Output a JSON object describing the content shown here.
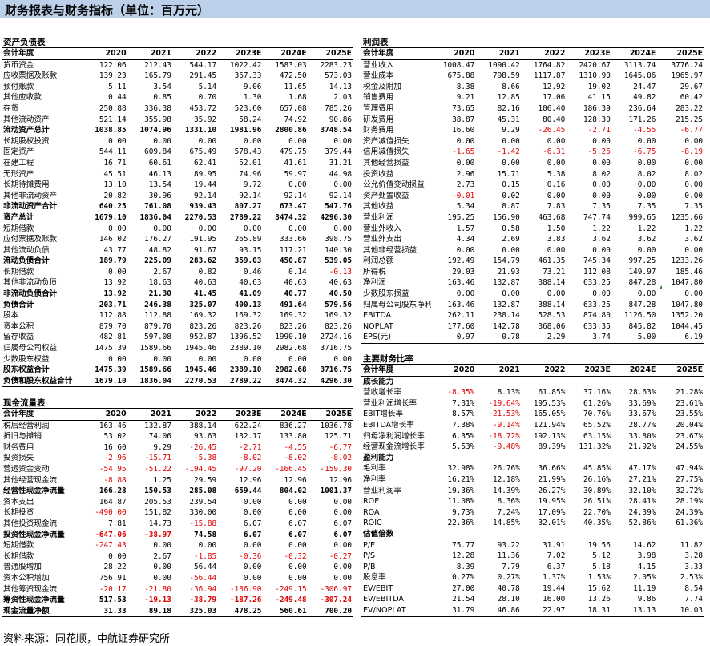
{
  "page_title": "财务报表与财务指标（单位：百万元）",
  "source_note": "资料来源：同花顺，中航证券研究所",
  "years": [
    "2020",
    "2021",
    "2022",
    "2023E",
    "2024E",
    "2025E"
  ],
  "balance_sheet": {
    "title": "资产负债表",
    "header": "会计年度",
    "rows": [
      {
        "label": "货币资金",
        "values": [
          "122.06",
          "212.43",
          "544.17",
          "1022.42",
          "1583.03",
          "2283.23"
        ]
      },
      {
        "label": "应收票据及账款",
        "values": [
          "139.23",
          "165.79",
          "291.45",
          "367.33",
          "472.50",
          "573.03"
        ]
      },
      {
        "label": "预付账款",
        "values": [
          "5.11",
          "3.54",
          "5.14",
          "9.06",
          "11.65",
          "14.13"
        ]
      },
      {
        "label": "其他应收款",
        "values": [
          "0.44",
          "0.85",
          "0.70",
          "1.30",
          "1.68",
          "2.03"
        ]
      },
      {
        "label": "存货",
        "values": [
          "250.88",
          "336.38",
          "453.72",
          "523.60",
          "657.08",
          "785.26"
        ]
      },
      {
        "label": "其他流动资产",
        "values": [
          "521.14",
          "355.98",
          "35.92",
          "58.24",
          "74.92",
          "90.86"
        ]
      },
      {
        "label": "流动资产总计",
        "bold": true,
        "values": [
          "1038.85",
          "1074.96",
          "1331.10",
          "1981.96",
          "2800.86",
          "3748.54"
        ]
      },
      {
        "label": "长期股权投资",
        "values": [
          "0.00",
          "0.00",
          "0.00",
          "0.00",
          "0.00",
          "0.00"
        ]
      },
      {
        "label": "固定资产",
        "values": [
          "544.11",
          "609.84",
          "675.49",
          "578.43",
          "479.75",
          "379.44"
        ]
      },
      {
        "label": "在建工程",
        "values": [
          "16.71",
          "60.61",
          "62.41",
          "52.01",
          "41.61",
          "31.21"
        ]
      },
      {
        "label": "无形资产",
        "values": [
          "45.51",
          "46.13",
          "89.95",
          "74.96",
          "59.97",
          "44.98"
        ]
      },
      {
        "label": "长期待摊费用",
        "values": [
          "13.10",
          "13.54",
          "19.44",
          "9.72",
          "0.00",
          "0.00"
        ]
      },
      {
        "label": "其他非流动资产",
        "values": [
          "20.82",
          "30.96",
          "92.14",
          "92.14",
          "92.14",
          "92.14"
        ]
      },
      {
        "label": "非流动资产合计",
        "bold": true,
        "values": [
          "640.25",
          "761.08",
          "939.43",
          "807.27",
          "673.47",
          "547.76"
        ]
      },
      {
        "label": "资产总计",
        "bold": true,
        "values": [
          "1679.10",
          "1836.04",
          "2270.53",
          "2789.22",
          "3474.32",
          "4296.30"
        ]
      },
      {
        "label": "短期借款",
        "values": [
          "0.00",
          "0.00",
          "0.00",
          "0.00",
          "0.00",
          "0.00"
        ]
      },
      {
        "label": "应付票据及账款",
        "values": [
          "146.02",
          "176.27",
          "191.95",
          "265.89",
          "333.66",
          "398.75"
        ]
      },
      {
        "label": "其他流动负债",
        "values": [
          "43.77",
          "48.82",
          "91.67",
          "93.15",
          "117.21",
          "140.30"
        ]
      },
      {
        "label": "流动负债合计",
        "bold": true,
        "values": [
          "189.79",
          "225.09",
          "283.62",
          "359.03",
          "450.87",
          "539.05"
        ]
      },
      {
        "label": "长期借款",
        "values": [
          "0.00",
          "2.67",
          "0.82",
          "0.46",
          "0.14",
          "-0.13"
        ]
      },
      {
        "label": "其他非流动负债",
        "values": [
          "13.92",
          "18.63",
          "40.63",
          "40.63",
          "40.63",
          "40.63"
        ]
      },
      {
        "label": "非流动负债合计",
        "bold": true,
        "values": [
          "13.92",
          "21.30",
          "41.45",
          "41.09",
          "40.77",
          "40.50"
        ]
      },
      {
        "label": "负债合计",
        "bold": true,
        "values": [
          "203.71",
          "246.38",
          "325.07",
          "400.13",
          "491.64",
          "579.56"
        ]
      },
      {
        "label": "股本",
        "values": [
          "112.88",
          "112.88",
          "169.32",
          "169.32",
          "169.32",
          "169.32"
        ]
      },
      {
        "label": "资本公积",
        "values": [
          "879.70",
          "879.70",
          "823.26",
          "823.26",
          "823.26",
          "823.26"
        ]
      },
      {
        "label": "留存收益",
        "values": [
          "482.81",
          "597.08",
          "952.87",
          "1396.52",
          "1990.10",
          "2724.16"
        ]
      },
      {
        "label": "归属母公司权益",
        "values": [
          "1475.39",
          "1589.66",
          "1945.46",
          "2389.10",
          "2982.68",
          "3716.75"
        ]
      },
      {
        "label": "少数股东权益",
        "values": [
          "0.00",
          "0.00",
          "0.00",
          "0.00",
          "0.00",
          "0.00"
        ]
      },
      {
        "label": "股东权益合计",
        "bold": true,
        "values": [
          "1475.39",
          "1589.66",
          "1945.46",
          "2389.10",
          "2982.68",
          "3716.75"
        ]
      },
      {
        "label": "负债和股东权益合计",
        "bold": true,
        "values": [
          "1679.10",
          "1836.04",
          "2270.53",
          "2789.22",
          "3474.32",
          "4296.30"
        ]
      }
    ]
  },
  "cash_flow": {
    "title": "现金流量表",
    "header": "会计年度",
    "rows": [
      {
        "label": "税后经营利润",
        "values": [
          "163.46",
          "132.87",
          "388.14",
          "622.24",
          "836.27",
          "1036.78"
        ]
      },
      {
        "label": "折旧与摊销",
        "values": [
          "53.02",
          "74.06",
          "93.63",
          "132.17",
          "133.80",
          "125.71"
        ]
      },
      {
        "label": "财务费用",
        "values": [
          "16.60",
          "9.29",
          "-26.45",
          "-2.71",
          "-4.55",
          "-6.77"
        ]
      },
      {
        "label": "投资损失",
        "values": [
          "-2.96",
          "-15.71",
          "-5.38",
          "-8.02",
          "-8.02",
          "-8.02"
        ]
      },
      {
        "label": "营运资金变动",
        "values": [
          "-54.95",
          "-51.22",
          "-194.45",
          "-97.20",
          "-166.45",
          "-159.30"
        ]
      },
      {
        "label": "其他经营现金流",
        "values": [
          "-8.88",
          "1.25",
          "29.59",
          "12.96",
          "12.96",
          "12.96"
        ]
      },
      {
        "label": "经营性现金净流量",
        "bold": true,
        "values": [
          "166.28",
          "150.53",
          "285.08",
          "659.44",
          "804.02",
          "1001.37"
        ]
      },
      {
        "label": "资本支出",
        "values": [
          "164.87",
          "205.53",
          "239.54",
          "0.00",
          "0.00",
          "0.00"
        ]
      },
      {
        "label": "长期投资",
        "values": [
          "-490.00",
          "151.82",
          "330.00",
          "0.00",
          "0.00",
          "0.00"
        ]
      },
      {
        "label": "其他投资现金流",
        "values": [
          "7.81",
          "14.73",
          "-15.88",
          "6.07",
          "6.07",
          "6.07"
        ]
      },
      {
        "label": "投资性现金净流量",
        "bold": true,
        "values": [
          "-647.06",
          "-38.97",
          "74.58",
          "6.07",
          "6.07",
          "6.07"
        ]
      },
      {
        "label": "短期借款",
        "values": [
          "-247.43",
          "0.00",
          "0.00",
          "0.00",
          "0.00",
          "0.00"
        ]
      },
      {
        "label": "长期借款",
        "values": [
          "0.00",
          "2.67",
          "-1.85",
          "-0.36",
          "-0.32",
          "-0.27"
        ]
      },
      {
        "label": "普通股增加",
        "values": [
          "28.22",
          "0.00",
          "56.44",
          "0.00",
          "0.00",
          "0.00"
        ]
      },
      {
        "label": "资本公积增加",
        "values": [
          "756.91",
          "0.00",
          "-56.44",
          "0.00",
          "0.00",
          "0.00"
        ]
      },
      {
        "label": "其他筹资现金流",
        "values": [
          "-20.17",
          "-21.80",
          "-36.94",
          "-186.90",
          "-249.15",
          "-306.97"
        ]
      },
      {
        "label": "筹资性现金净流量",
        "bold": true,
        "values": [
          "517.53",
          "-19.13",
          "-38.79",
          "-187.26",
          "-249.48",
          "-307.24"
        ]
      },
      {
        "label": "现金流量净额",
        "bold": true,
        "values": [
          "31.33",
          "89.18",
          "325.03",
          "478.25",
          "560.61",
          "700.20"
        ]
      }
    ]
  },
  "income": {
    "title": "利润表",
    "header": "会计年度",
    "rows": [
      {
        "label": "营业收入",
        "values": [
          "1008.47",
          "1090.42",
          "1764.82",
          "2420.67",
          "3113.74",
          "3776.24"
        ]
      },
      {
        "label": "营业成本",
        "values": [
          "675.88",
          "798.59",
          "1117.87",
          "1310.90",
          "1645.06",
          "1965.97"
        ]
      },
      {
        "label": "税金及附加",
        "values": [
          "8.38",
          "8.66",
          "12.92",
          "19.02",
          "24.47",
          "29.67"
        ]
      },
      {
        "label": "销售费用",
        "values": [
          "9.21",
          "12.85",
          "17.06",
          "41.15",
          "49.82",
          "60.42"
        ]
      },
      {
        "label": "管理费用",
        "values": [
          "73.65",
          "82.16",
          "106.40",
          "186.39",
          "236.64",
          "283.22"
        ]
      },
      {
        "label": "研发费用",
        "values": [
          "38.87",
          "45.31",
          "80.40",
          "128.30",
          "171.26",
          "215.25"
        ]
      },
      {
        "label": "财务费用",
        "values": [
          "16.60",
          "9.29",
          "-26.45",
          "-2.71",
          "-4.55",
          "-6.77"
        ]
      },
      {
        "label": "资产减值损失",
        "values": [
          "0.00",
          "0.00",
          "0.00",
          "0.00",
          "0.00",
          "0.00"
        ]
      },
      {
        "label": "信用减值损失",
        "values": [
          "-1.65",
          "-1.42",
          "-6.31",
          "-5.25",
          "-6.75",
          "-8.19"
        ]
      },
      {
        "label": "其他经营损益",
        "values": [
          "0.00",
          "0.00",
          "0.00",
          "0.00",
          "0.00",
          "0.00"
        ]
      },
      {
        "label": "投资收益",
        "values": [
          "2.96",
          "15.71",
          "5.38",
          "8.02",
          "8.02",
          "8.02"
        ]
      },
      {
        "label": "公允价值变动损益",
        "values": [
          "2.73",
          "0.15",
          "0.16",
          "0.00",
          "0.00",
          "0.00"
        ]
      },
      {
        "label": "资产处置收益",
        "values": [
          "-0.01",
          "0.02",
          "0.00",
          "0.00",
          "0.00",
          "0.00"
        ]
      },
      {
        "label": "其他收益",
        "values": [
          "5.34",
          "8.87",
          "7.83",
          "7.35",
          "7.35",
          "7.35"
        ]
      },
      {
        "label": "营业利润",
        "values": [
          "195.25",
          "156.90",
          "463.68",
          "747.74",
          "999.65",
          "1235.66"
        ]
      },
      {
        "label": "营业外收入",
        "values": [
          "1.57",
          "0.58",
          "1.50",
          "1.22",
          "1.22",
          "1.22"
        ]
      },
      {
        "label": "营业外支出",
        "values": [
          "4.34",
          "2.69",
          "3.83",
          "3.62",
          "3.62",
          "3.62"
        ]
      },
      {
        "label": "其他非经营损益",
        "values": [
          "0.00",
          "0.00",
          "0.00",
          "0.00",
          "0.00",
          "0.00"
        ]
      },
      {
        "label": "利润总额",
        "values": [
          "192.49",
          "154.79",
          "461.35",
          "745.34",
          "997.25",
          "1233.26"
        ]
      },
      {
        "label": "所得税",
        "values": [
          "29.03",
          "21.93",
          "73.21",
          "112.08",
          "149.97",
          "185.46"
        ]
      },
      {
        "label": "净利润",
        "values": [
          "163.46",
          "132.87",
          "388.14",
          "633.25",
          "847.28",
          "1047.80"
        ]
      },
      {
        "label": "少数股东损益",
        "values": [
          "0.00",
          "0.00",
          "0.00",
          "0.00",
          "0.00",
          "0.00"
        ]
      },
      {
        "label": "归属母公司股东净利",
        "values": [
          "163.46",
          "132.87",
          "388.14",
          "633.25",
          "847.28",
          "1047.80"
        ]
      },
      {
        "label": "EBITDA",
        "values": [
          "262.11",
          "238.14",
          "528.53",
          "874.80",
          "1126.50",
          "1352.20"
        ]
      },
      {
        "label": "NOPLAT",
        "values": [
          "177.60",
          "142.78",
          "368.06",
          "633.35",
          "845.82",
          "1044.45"
        ]
      },
      {
        "label": "EPS(元)",
        "values": [
          "0.97",
          "0.78",
          "2.29",
          "3.74",
          "5.00",
          "6.19"
        ]
      }
    ]
  },
  "ratios": {
    "title": "主要财务比率",
    "header": "会计年度",
    "rows": [
      {
        "label": "成长能力",
        "section": true,
        "values": [
          "",
          "",
          "",
          "",
          "",
          ""
        ]
      },
      {
        "label": "营收增长率",
        "values": [
          "-8.35%",
          "8.13%",
          "61.85%",
          "37.16%",
          "28.63%",
          "21.28%"
        ]
      },
      {
        "label": "营业利润增长率",
        "values": [
          "7.31%",
          "-19.64%",
          "195.53%",
          "61.26%",
          "33.69%",
          "23.61%"
        ]
      },
      {
        "label": "EBIT增长率",
        "values": [
          "8.57%",
          "-21.53%",
          "165.05%",
          "70.76%",
          "33.67%",
          "23.55%"
        ]
      },
      {
        "label": "EBITDA增长率",
        "values": [
          "7.38%",
          "-9.14%",
          "121.94%",
          "65.52%",
          "28.77%",
          "20.04%"
        ]
      },
      {
        "label": "归母净利润增长率",
        "values": [
          "6.35%",
          "-18.72%",
          "192.13%",
          "63.15%",
          "33.80%",
          "23.67%"
        ]
      },
      {
        "label": "经营现金流增长率",
        "values": [
          "5.53%",
          "-9.48%",
          "89.39%",
          "131.32%",
          "21.92%",
          "24.55%"
        ]
      },
      {
        "label": "盈利能力",
        "section": true,
        "values": [
          "",
          "",
          "",
          "",
          "",
          ""
        ]
      },
      {
        "label": "毛利率",
        "values": [
          "32.98%",
          "26.76%",
          "36.66%",
          "45.85%",
          "47.17%",
          "47.94%"
        ]
      },
      {
        "label": "净利率",
        "values": [
          "16.21%",
          "12.18%",
          "21.99%",
          "26.16%",
          "27.21%",
          "27.75%"
        ]
      },
      {
        "label": "营业利润率",
        "values": [
          "19.36%",
          "14.39%",
          "26.27%",
          "30.89%",
          "32.10%",
          "32.72%"
        ]
      },
      {
        "label": "ROE",
        "values": [
          "11.08%",
          "8.36%",
          "19.95%",
          "26.51%",
          "28.41%",
          "28.19%"
        ]
      },
      {
        "label": "ROA",
        "values": [
          "9.73%",
          "7.24%",
          "17.09%",
          "22.70%",
          "24.39%",
          "24.39%"
        ]
      },
      {
        "label": "ROIC",
        "values": [
          "22.36%",
          "14.85%",
          "32.01%",
          "40.35%",
          "52.86%",
          "61.36%"
        ]
      },
      {
        "label": "估值倍数",
        "section": true,
        "values": [
          "",
          "",
          "",
          "",
          "",
          ""
        ]
      },
      {
        "label": "P/E",
        "values": [
          "75.77",
          "93.22",
          "31.91",
          "19.56",
          "14.62",
          "11.82"
        ]
      },
      {
        "label": "P/S",
        "values": [
          "12.28",
          "11.36",
          "7.02",
          "5.12",
          "3.98",
          "3.28"
        ]
      },
      {
        "label": "P/B",
        "values": [
          "8.39",
          "7.79",
          "6.37",
          "5.18",
          "4.15",
          "3.33"
        ]
      },
      {
        "label": "股息率",
        "values": [
          "0.27%",
          "0.27%",
          "1.37%",
          "1.53%",
          "2.05%",
          "2.53%"
        ]
      },
      {
        "label": "EV/EBIT",
        "values": [
          "27.00",
          "40.78",
          "19.44",
          "15.62",
          "11.19",
          "8.54"
        ]
      },
      {
        "label": "EV/EBITDA",
        "values": [
          "21.54",
          "28.10",
          "16.00",
          "13.26",
          "9.86",
          "7.74"
        ]
      },
      {
        "label": "EV/NOPLAT",
        "values": [
          "31.79",
          "46.86",
          "22.97",
          "18.31",
          "13.13",
          "10.03"
        ]
      }
    ]
  }
}
